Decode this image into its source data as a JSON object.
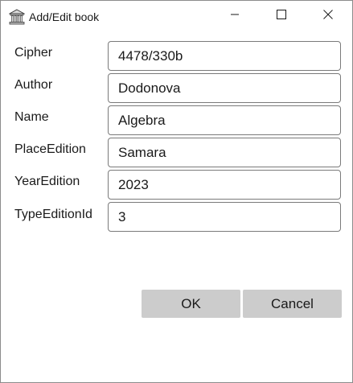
{
  "window": {
    "title": "Add/Edit book"
  },
  "form": {
    "fields": [
      {
        "label": "Cipher",
        "value": "4478/330b"
      },
      {
        "label": "Author",
        "value": "Dodonova"
      },
      {
        "label": "Name",
        "value": "Algebra"
      },
      {
        "label": "PlaceEdition",
        "value": "Samara"
      },
      {
        "label": "YearEdition",
        "value": "2023"
      },
      {
        "label": "TypeEditionId",
        "value": "3"
      }
    ]
  },
  "buttons": {
    "ok_label": "OK",
    "cancel_label": "Cancel"
  },
  "icons": {
    "app": "library-building-icon",
    "minimize": "minimize-icon",
    "maximize": "maximize-icon",
    "close": "close-icon"
  }
}
